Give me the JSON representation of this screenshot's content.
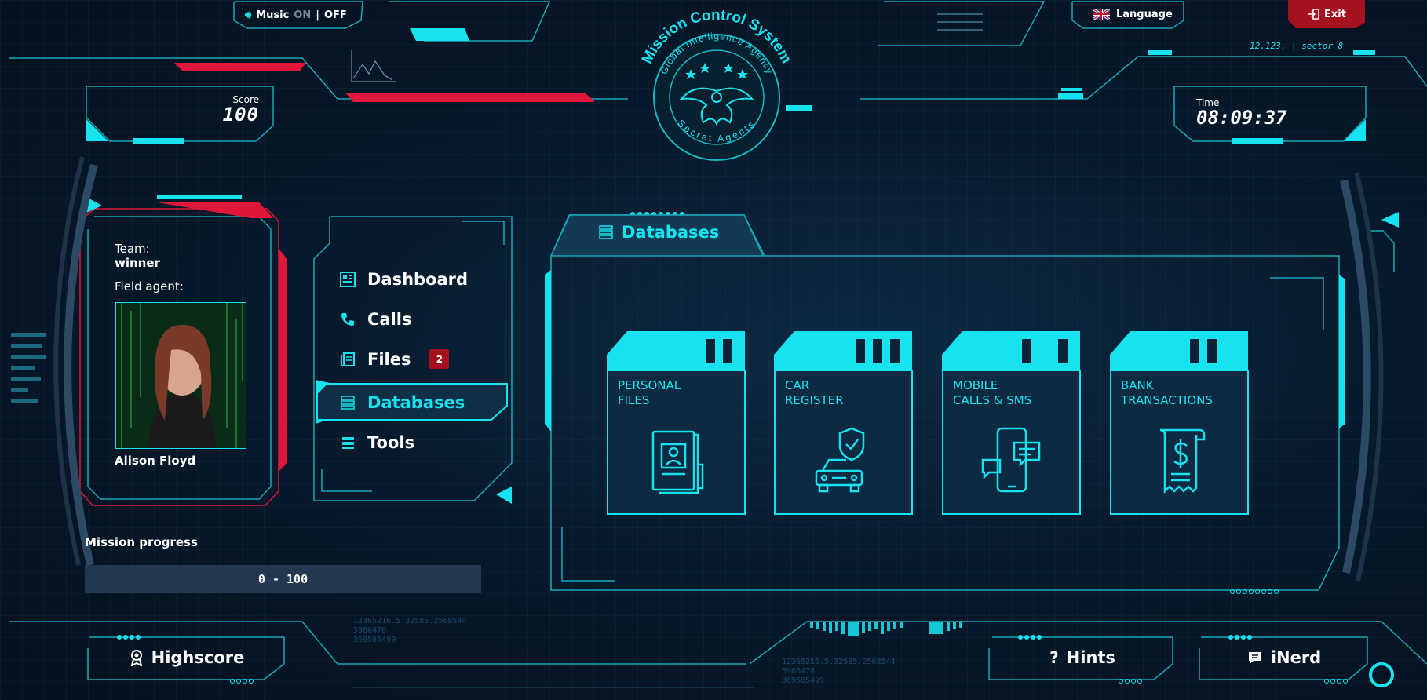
{
  "top": {
    "music_label": "Music",
    "music_on": "ON",
    "music_sep": "|",
    "music_off": "OFF",
    "language_label": "Language",
    "exit_label": "Exit",
    "sector_text": "12.123. | sector 8"
  },
  "emblem": {
    "title": "Mission Control System",
    "agency": "Global Intelligence Agency",
    "motto": "Secret Agents"
  },
  "score": {
    "label": "Score",
    "value": "100"
  },
  "time": {
    "label": "Time",
    "value": "08:09:37"
  },
  "team_card": {
    "team_label": "Team:",
    "team_value": "winner",
    "agent_label": "Field agent:",
    "agent_name": "Alison Floyd"
  },
  "nav": {
    "items": [
      {
        "label": "Dashboard",
        "icon": "dashboard-icon"
      },
      {
        "label": "Calls",
        "icon": "phone-icon"
      },
      {
        "label": "Files",
        "icon": "files-icon",
        "badge": "2"
      },
      {
        "label": "Databases",
        "icon": "database-icon",
        "active": true
      },
      {
        "label": "Tools",
        "icon": "tools-icon"
      }
    ]
  },
  "databases": {
    "title": "Databases",
    "cards": [
      {
        "line1": "PERSONAL",
        "line2": "FILES",
        "icon": "personal-file-icon"
      },
      {
        "line1": "CAR",
        "line2": "REGISTER",
        "icon": "car-shield-icon"
      },
      {
        "line1": "MOBILE",
        "line2": "CALLS & SMS",
        "icon": "phone-chat-icon"
      },
      {
        "line1": "BANK",
        "line2": "TRANSACTIONS",
        "icon": "receipt-dollar-icon"
      }
    ]
  },
  "progress": {
    "label": "Mission progress",
    "text": "0 - 100",
    "value": 0
  },
  "bottom": {
    "highscore_label": "Highscore",
    "hints_label": "Hints",
    "inerd_label": "iNerd",
    "deco_numbers_1": "12365216.5.32585.2568544",
    "deco_numbers_2": "5986478",
    "deco_numbers_3": "3695854​99"
  },
  "colors": {
    "accent": "#16e3ef",
    "danger": "#a5121f",
    "bg": "#061423"
  }
}
